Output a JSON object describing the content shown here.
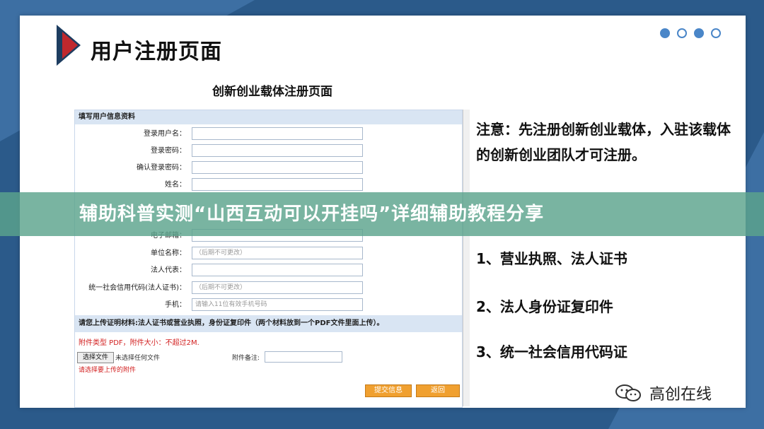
{
  "slide": {
    "title": "用户注册页面",
    "note": "注意：先注册创新创业载体，入驻该载体的创新创业团队才可注册。",
    "requirements": [
      "1、营业执照、法人证书",
      "2、法人身份证复印件",
      "3、统一社会信用代码证"
    ]
  },
  "banner": {
    "text": "辅助科普实测“山西互动可以开挂吗”详细辅助教程分享"
  },
  "watermark": {
    "text": "高创在线"
  },
  "form": {
    "heading": "创新创业载体注册页面",
    "section_title": "填写用户信息资料",
    "fields": [
      {
        "label": "登录用户名：",
        "placeholder": ""
      },
      {
        "label": "登录密码：",
        "placeholder": ""
      },
      {
        "label": "确认登录密码：",
        "placeholder": ""
      },
      {
        "label": "姓名：",
        "placeholder": ""
      },
      {
        "label": "电子邮箱：",
        "placeholder": ""
      },
      {
        "label": "单位名称：",
        "placeholder": "（后期不可更改）"
      },
      {
        "label": "法人代表：",
        "placeholder": ""
      },
      {
        "label": "统一社会信用代码(法人证书)：",
        "placeholder": "（后期不可更改）"
      },
      {
        "label": "手机：",
        "placeholder": "请输入11位有效手机号码"
      }
    ],
    "upload_title": "请您上传证明材料:法人证书或营业执照，身份证复印件（两个材料放到一个PDF文件里面上传）。",
    "upload_hint": "附件类型 PDF，附件大小：不超过2M.",
    "choose_file": "选择文件",
    "no_file": "未选择任何文件",
    "attach_note_label": "附件备注:",
    "delete_hint": "请选择要上传的附件",
    "submit": "提交信息",
    "back": "返回"
  },
  "colors": {
    "accent": "#4a86c8",
    "banner": "#5ca48c",
    "warning": "#d21f1f",
    "button": "#f0a030"
  }
}
